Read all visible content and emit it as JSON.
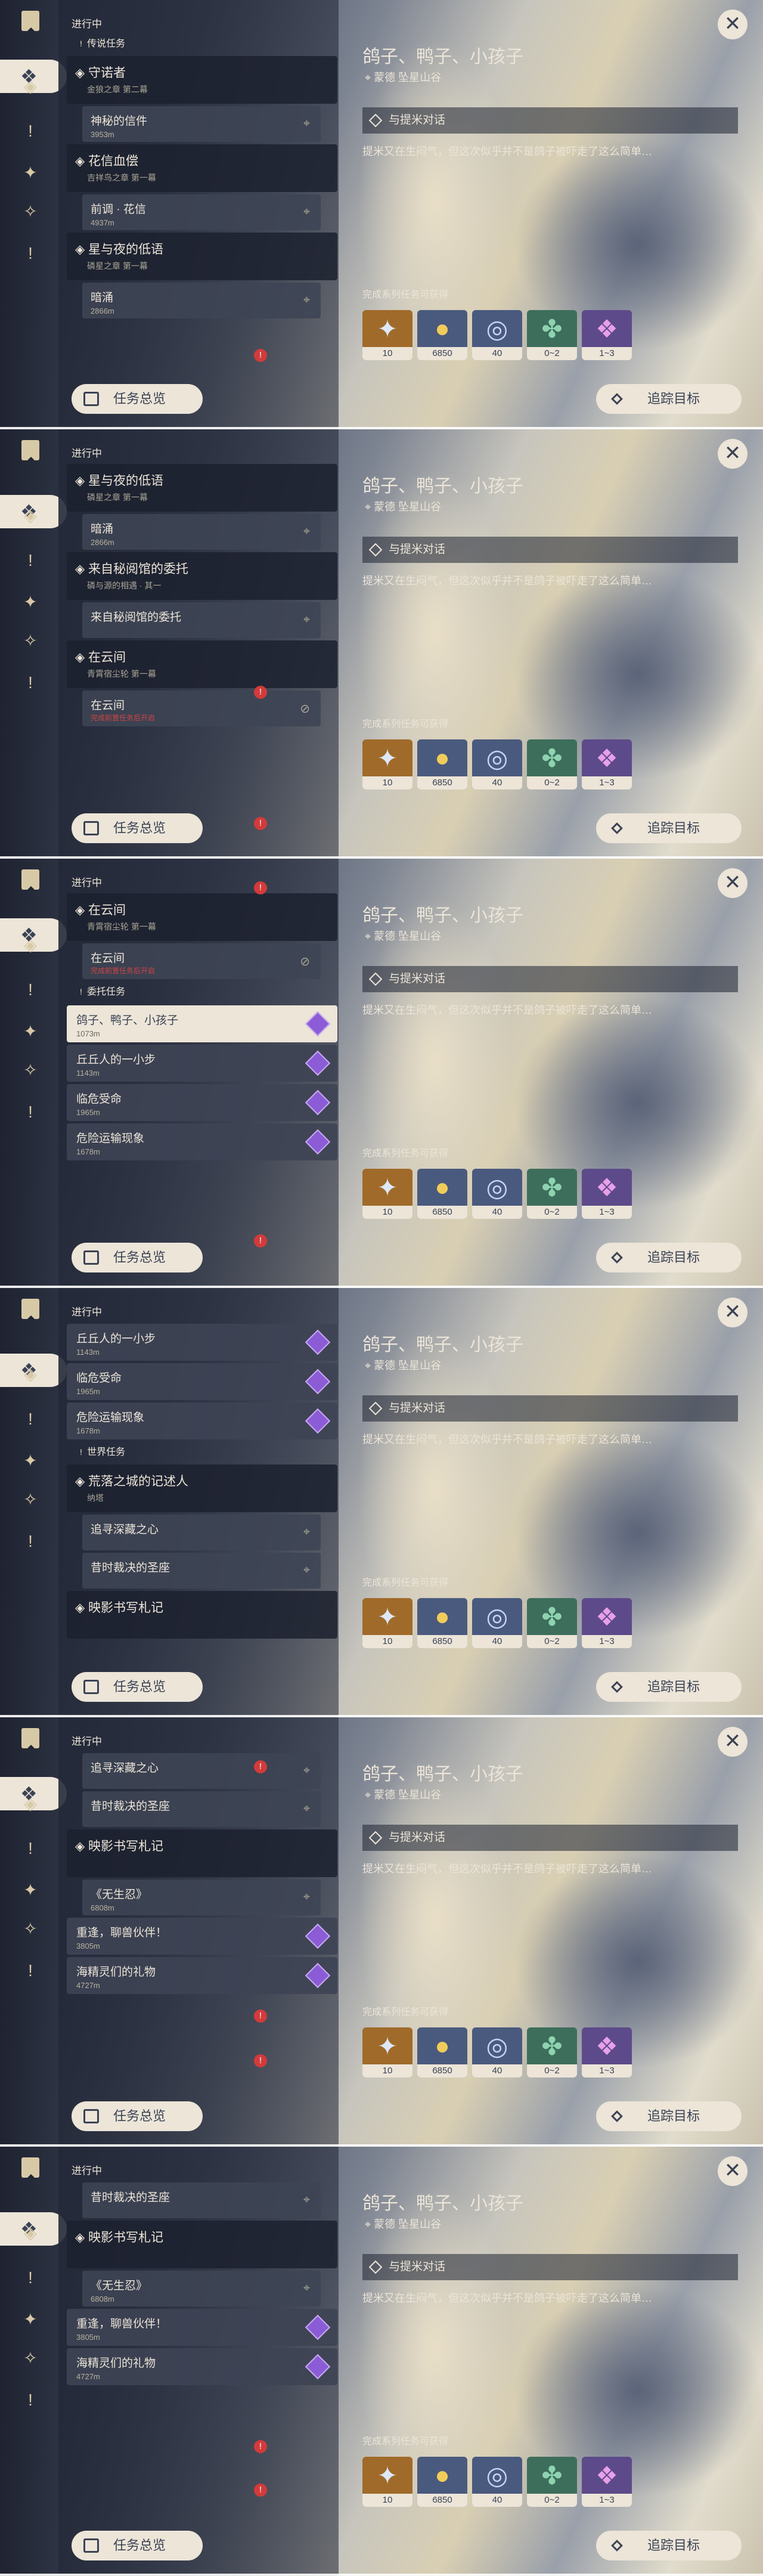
{
  "panel_heading": "进行中",
  "sections": {
    "legend": "传说任务",
    "commission": "委托任务",
    "world": "世界任务"
  },
  "quests": {
    "guardian": {
      "title": "守诺者",
      "sub": "金狼之章 第二幕"
    },
    "guardian_step": {
      "title": "神秘的信件",
      "dist": "3953m"
    },
    "flower": {
      "title": "花信血偿",
      "sub": "吉祥鸟之章 第一幕"
    },
    "flower_step": {
      "title": "前调 · 花信",
      "dist": "4937m"
    },
    "star": {
      "title": "星与夜的低语",
      "sub": "磷星之章 第一幕"
    },
    "star_step": {
      "title": "暗涌",
      "dist": "2866m"
    },
    "secret": {
      "title": "来自秘阅馆的委托",
      "sub": "磷与源的相遇 · 其一"
    },
    "secret_step": {
      "title": "来自秘阅馆的委托"
    },
    "cloud": {
      "title": "在云间",
      "sub": "青霄宿尘轮 第一幕"
    },
    "cloud_step": {
      "title": "在云间",
      "note": "完成前置任务后开启"
    },
    "c1": {
      "title": "鸽子、鸭子、小孩子",
      "dist": "1073m"
    },
    "c2": {
      "title": "丘丘人的一小步",
      "dist": "1143m"
    },
    "c3": {
      "title": "临危受命",
      "dist": "1965m"
    },
    "c4": {
      "title": "危险运输现象",
      "dist": "1678m"
    },
    "ruin": {
      "title": "荒落之城的记述人",
      "sub": "纳塔"
    },
    "ruin_s1": {
      "title": "追寻深藏之心"
    },
    "ruin_s2": {
      "title": "昔时裁决的圣座"
    },
    "shadow": {
      "title": "映影书写札记"
    },
    "shadow_s1": {
      "title": "《无生忍》",
      "dist": "6808m"
    },
    "shadow_s2": {
      "title": "重逢，聊兽伙伴！",
      "dist": "3805m"
    },
    "shadow_s3": {
      "title": "海精灵们的礼物",
      "dist": "4727m"
    }
  },
  "overview_label": "任务总览",
  "detail": {
    "title": "鸽子、鸭子、小孩子",
    "location": "蒙德 坠星山谷",
    "objective": "与提米对话",
    "description": "提米又在生闷气，但这次似乎并不是鸽子被吓走了这么简单…",
    "rewards_label": "完成系列任务可获得",
    "rewards": [
      {
        "name": "primogem",
        "amount": "10",
        "bg": "#a06a2a"
      },
      {
        "name": "mora",
        "amount": "6850",
        "bg": "#4a5a7e"
      },
      {
        "name": "adventure-exp",
        "amount": "40",
        "bg": "#4a5a7e"
      },
      {
        "name": "companionship-exp",
        "amount": "0~2",
        "bg": "#3d6e5b"
      },
      {
        "name": "crystal-ore",
        "amount": "1~3",
        "bg": "#5d4a8a"
      }
    ]
  },
  "track_label": "追踪目标",
  "icons": {
    "close": "✕",
    "location": "📍",
    "diamond": "◆",
    "bang": "!"
  },
  "colors": {
    "accent": "#ece5d8",
    "quest_bar": "#d8c9a6",
    "commission_gem": "#8b5cd6",
    "alert": "#d23b3b"
  }
}
